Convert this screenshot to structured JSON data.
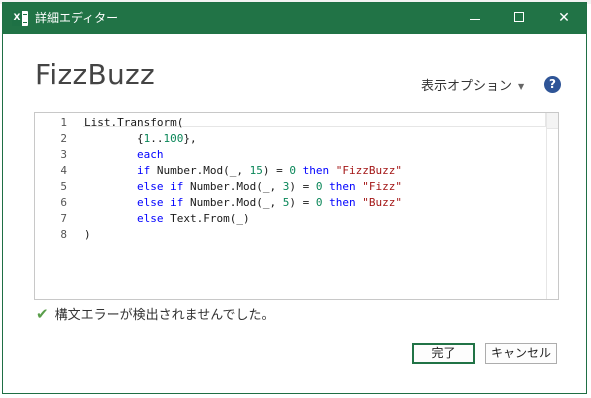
{
  "window": {
    "title": "詳細エディター",
    "app_icon_letter": "X",
    "close_glyph": "✕"
  },
  "header": {
    "query_name": "FizzBuzz",
    "display_options": "表示オプション",
    "help_glyph": "?"
  },
  "editor": {
    "lines": [
      {
        "no": "1",
        "text": "List.Transform("
      },
      {
        "no": "2",
        "text": "        {1..100},"
      },
      {
        "no": "3",
        "text": "        each"
      },
      {
        "no": "4",
        "text": "        if Number.Mod(_, 15) = 0 then \"FizzBuzz\""
      },
      {
        "no": "5",
        "text": "        else if Number.Mod(_, 3) = 0 then \"Fizz\""
      },
      {
        "no": "6",
        "text": "        else if Number.Mod(_, 5) = 0 then \"Buzz\""
      },
      {
        "no": "7",
        "text": "        else Text.From(_)"
      },
      {
        "no": "8",
        "text": ")"
      }
    ]
  },
  "status": {
    "message": "構文エラーが検出されませんでした。",
    "icon": "check-icon"
  },
  "buttons": {
    "done": "完了",
    "cancel": "キャンセル"
  },
  "colors": {
    "titlebar": "#217346",
    "keyword": "#0000ff",
    "string": "#a31515",
    "number": "#098658",
    "check": "#5a9e4b"
  }
}
